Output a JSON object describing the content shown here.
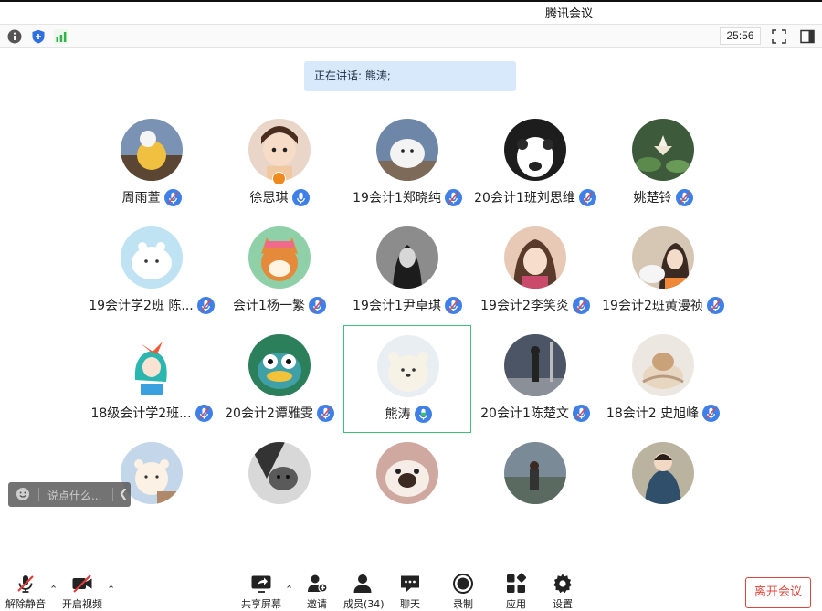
{
  "window": {
    "title": "腾讯会议"
  },
  "infobar": {
    "timer": "25:56"
  },
  "speaking": {
    "label": "正在讲话: 熊涛;"
  },
  "participants": [
    {
      "name": "周雨萱",
      "avatar": "bg-plush"
    },
    {
      "name": "徐思琪",
      "avatar": "bg-child"
    },
    {
      "name": "19会计1郑晓纯",
      "avatar": "bg-bird"
    },
    {
      "name": "20会计1班刘思维",
      "avatar": "bg-dog"
    },
    {
      "name": "姚楚铃",
      "avatar": "bg-lotus"
    },
    {
      "name": "19会计学2班 陈...",
      "avatar": "bg-moomin"
    },
    {
      "name": "会计1杨一繁",
      "avatar": "bg-shiba"
    },
    {
      "name": "19会计1尹卓琪",
      "avatar": "bg-girl-bw"
    },
    {
      "name": "19会计2李笑炎",
      "avatar": "bg-girl"
    },
    {
      "name": "19会计2班黄漫祯",
      "avatar": "bg-girl2"
    },
    {
      "name": "18级会计学2班...",
      "avatar": "bg-anime"
    },
    {
      "name": "20会计2谭雅雯",
      "avatar": "bg-frog"
    },
    {
      "name": "熊涛",
      "avatar": "bg-bear"
    },
    {
      "name": "20会计1陈楚文",
      "avatar": "bg-street"
    },
    {
      "name": "18会计2 史旭峰",
      "avatar": "bg-cat"
    },
    {
      "name": "",
      "avatar": "bg-bear2"
    },
    {
      "name": "",
      "avatar": "bg-bw-cat"
    },
    {
      "name": "",
      "avatar": "bg-pug"
    },
    {
      "name": "",
      "avatar": "bg-lake"
    },
    {
      "name": "",
      "avatar": "bg-kid"
    }
  ],
  "chat": {
    "placeholder": "说点什么..."
  },
  "toolbar": {
    "unmute": "解除静音",
    "video": "开启视频",
    "share": "共享屏幕",
    "invite": "邀请",
    "members": "成员(34)",
    "chat": "聊天",
    "record": "录制",
    "apps": "应用",
    "settings": "设置",
    "leave": "离开会议"
  },
  "colors": {
    "accent": "#3f7fe8",
    "leave": "#e0453d",
    "active_border": "#3cc07a",
    "speaking_bg": "#d8e9fb"
  }
}
